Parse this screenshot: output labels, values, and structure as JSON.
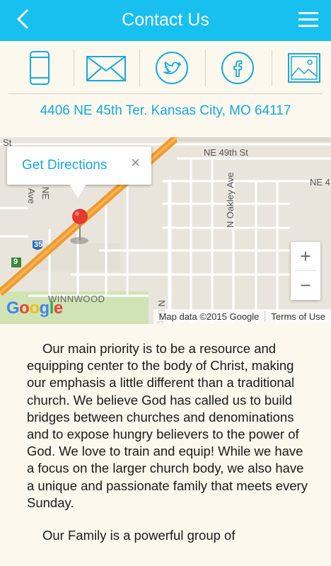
{
  "header": {
    "title": "Contact Us"
  },
  "icons": [
    "phone-icon",
    "mail-icon",
    "twitter-icon",
    "facebook-icon",
    "image-icon"
  ],
  "address": "4406 NE 45th Ter. Kansas City, MO 64117",
  "map": {
    "popup_link": "Get Directions",
    "popup_close": "×",
    "labels": {
      "st": "St",
      "ne49": "NE 49th St",
      "ne_right": "NE 4",
      "oakley": "N Oakley Ave",
      "brighton": "N Brighton A",
      "ave": "Ave",
      "ne_left": "NE",
      "winnwood": "WINNWOOD",
      "i35": "35",
      "route9": "9"
    },
    "zoom_in": "+",
    "zoom_out": "−",
    "google": "Google",
    "map_data": "Map data ©2015 Google",
    "terms": "Terms of Use"
  },
  "content": {
    "p1": "Our main priority is to be a resource and equipping center to the body of Christ, making our emphasis a little different than a traditional church. We believe God has called us to build bridges between churches and denominations and to expose hungry believers to the power of God. We love to train and equip! While we have a focus on the larger church body, we also have a unique and passionate family that meets every Sunday.",
    "p2": "Our Family is a powerful group of"
  },
  "colors": {
    "accent": "#17c0ee",
    "link": "#17a8de",
    "background": "#fdf8ed",
    "highway": "#f29a2e"
  }
}
